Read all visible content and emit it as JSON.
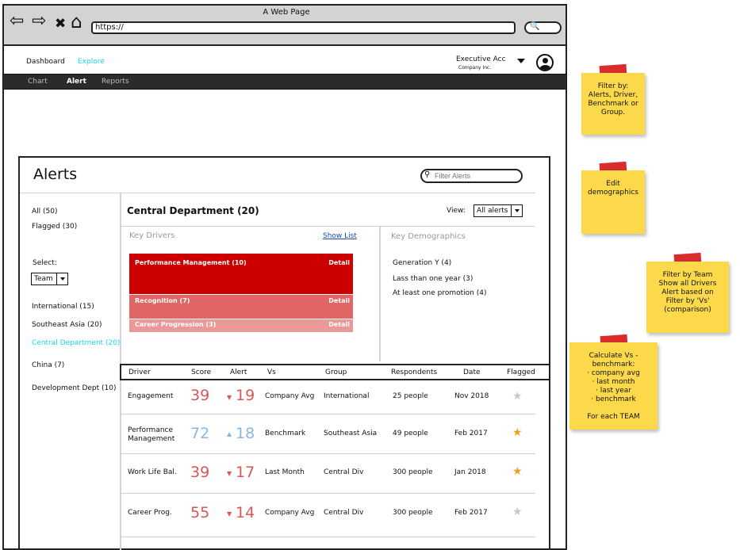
{
  "browser": {
    "window_title": "A Web Page",
    "url": "https://",
    "back_glyph": "⇦",
    "forward_glyph": "⇨",
    "close_glyph": "✖",
    "home_glyph": "⌂",
    "search_glyph": "🔍"
  },
  "header": {
    "nav": [
      "Dashboard",
      "Explore"
    ],
    "active_nav": "Explore",
    "user_name": "Executive Acc",
    "user_company": "Company Inc."
  },
  "subnav": {
    "tabs": [
      "Chart",
      "Alert",
      "Reports"
    ],
    "active": "Alert"
  },
  "panel": {
    "title": "Alerts",
    "filter_placeholder": "Filter Alerts"
  },
  "left": {
    "all": "All (50)",
    "flagged": "Flagged (30)",
    "select_label": "Select:",
    "select_value": "Team",
    "groups": [
      "International  (15)",
      "Southeast Asia (20)",
      "Central Department (20)",
      "China (7)",
      "Development Dept (10)"
    ],
    "active_group": "Central Department (20)"
  },
  "department": {
    "title": "Central Department (20)",
    "view_label": "View:",
    "view_value": "All alerts"
  },
  "key_drivers": {
    "label": "Key Drivers",
    "show_list": "Show List",
    "items": [
      {
        "label": "Performance Management (10)",
        "detail": "Detail",
        "count": 10
      },
      {
        "label": "Recognition (7)",
        "detail": "Detail",
        "count": 7
      },
      {
        "label": "Career Progression (3)",
        "detail": "Detail",
        "count": 3
      }
    ]
  },
  "key_demographics": {
    "label": "Key Demographics",
    "items": [
      "Generation Y (4)",
      "Lass than one year (3)",
      "At least one promotion (4)"
    ]
  },
  "table": {
    "headers": [
      "Driver",
      "Score",
      "Alert",
      "Vs",
      "Group",
      "Respondents",
      "Date",
      "Flagged"
    ],
    "rows": [
      {
        "driver": "Engagement",
        "score": "39",
        "alert": "19",
        "direction": "down",
        "vs": "Company Avg",
        "group": "International",
        "respondents": "25 people",
        "date": "Nov 2018",
        "flagged": false
      },
      {
        "driver": "Performance Management",
        "score": "72",
        "alert": "18",
        "direction": "up",
        "vs": "Benchmark",
        "group": "Southeast Asia",
        "respondents": "49 people",
        "date": "Feb 2017",
        "flagged": true
      },
      {
        "driver": "Work Life Bal.",
        "score": "39",
        "alert": "17",
        "direction": "down",
        "vs": "Last Month",
        "group": "Central Div",
        "respondents": "300 people",
        "date": "Jan 2018",
        "flagged": true
      },
      {
        "driver": "Career Prog.",
        "score": "55",
        "alert": "14",
        "direction": "down",
        "vs": "Company Avg",
        "group": "Central Div",
        "respondents": "300 people",
        "date": "Feb 2017",
        "flagged": false
      }
    ]
  },
  "notes": [
    {
      "text": "Filter by:\nAlerts, Driver,\nBenchmark or\nGroup."
    },
    {
      "text": "Edit\ndemographics"
    },
    {
      "text": "Filter by Team\nShow all Drivers\nAlert based on\nFilter by 'Vs'\n(comparison)"
    },
    {
      "text": "Calculate Vs -\nbenchmark:\n·  company avg\n·  last month\n·  last year\n·  benchmark\n\nFor each TEAM"
    }
  ],
  "colors": {
    "kd_1": "#cc0000",
    "kd_2": "#e06666",
    "kd_3": "#ea9999",
    "active_link": "#18d8f0",
    "score_red": "#d95757",
    "score_blue": "#8ab6e2",
    "star_on": "#f0a020",
    "star_off": "#c8c8c8"
  }
}
